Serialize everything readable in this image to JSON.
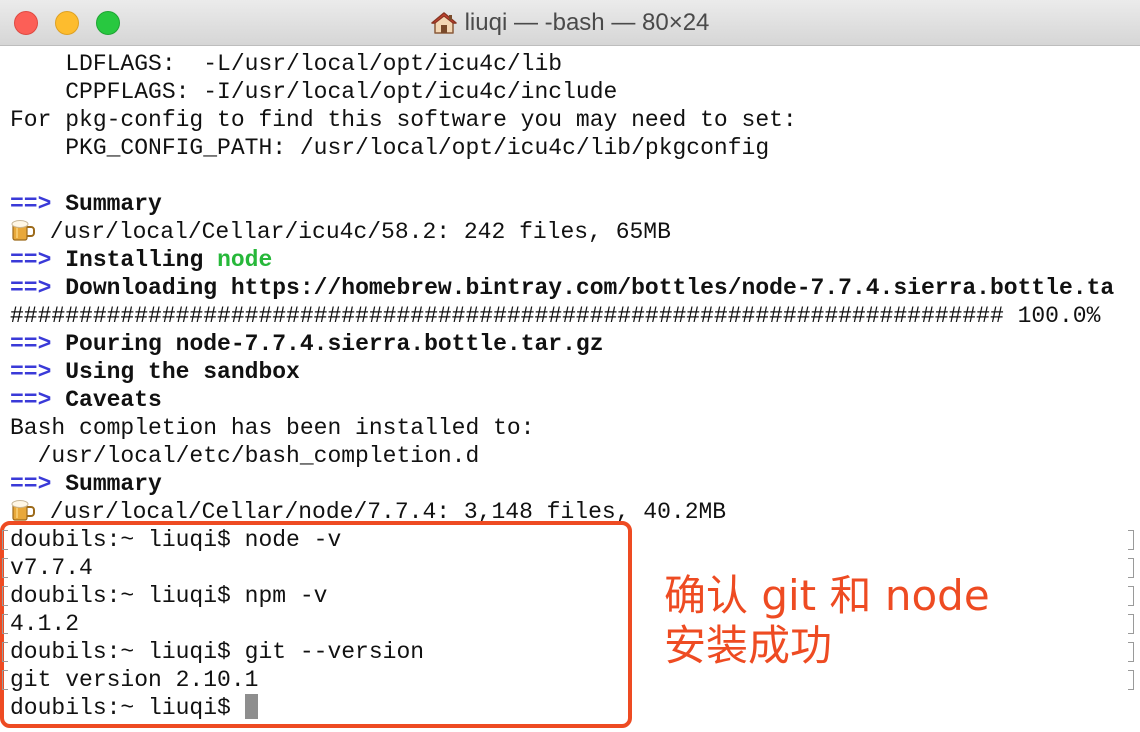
{
  "window": {
    "title": "liuqi — -bash — 80×24",
    "title_icon": "home-icon",
    "traffic_colors": {
      "close": "#fc5f57",
      "minimize": "#fdbc2e",
      "zoom": "#28c840"
    }
  },
  "colors": {
    "arrow": "#3a3ad8",
    "package_name": "#27b83a",
    "annotation": "#ee4b22",
    "cursor": "#8e8e8e"
  },
  "terminal": {
    "lines": [
      {
        "text": "    LDFLAGS:  -L/usr/local/opt/icu4c/lib"
      },
      {
        "text": "    CPPFLAGS: -I/usr/local/opt/icu4c/include"
      },
      {
        "text": "For pkg-config to find this software you may need to set:"
      },
      {
        "text": "    PKG_CONFIG_PATH: /usr/local/opt/icu4c/lib/pkgconfig"
      },
      {
        "text": ""
      },
      {
        "arrow": "==>",
        "label": " Summary"
      },
      {
        "icon": "beer-mug-icon",
        "text": " /usr/local/Cellar/icu4c/58.2: 242 files, 65MB"
      },
      {
        "arrow": "==>",
        "label": " Installing ",
        "highlight": "node"
      },
      {
        "arrow": "==>",
        "label": " Downloading https://homebrew.bintray.com/bottles/node-7.7.4.sierra.bottle.ta"
      },
      {
        "text": "######################################################################## 100.0%"
      },
      {
        "arrow": "==>",
        "label": " Pouring node-7.7.4.sierra.bottle.tar.gz"
      },
      {
        "arrow": "==>",
        "label": " Using the sandbox"
      },
      {
        "arrow": "==>",
        "label": " Caveats"
      },
      {
        "text": "Bash completion has been installed to:"
      },
      {
        "text": "  /usr/local/etc/bash_completion.d"
      },
      {
        "arrow": "==>",
        "label": " Summary"
      },
      {
        "icon": "beer-mug-icon",
        "text": " /usr/local/Cellar/node/7.7.4: 3,148 files, 40.2MB"
      },
      {
        "text": "doubils:~ liuqi$ node -v"
      },
      {
        "text": "v7.7.4"
      },
      {
        "text": "doubils:~ liuqi$ npm -v"
      },
      {
        "text": "4.1.2"
      },
      {
        "text": "doubils:~ liuqi$ git --version"
      },
      {
        "text": "git version 2.10.1"
      },
      {
        "text": "doubils:~ liuqi$ "
      }
    ]
  },
  "annotation": {
    "line1": "确认 git 和 node",
    "line2": "安装成功"
  }
}
